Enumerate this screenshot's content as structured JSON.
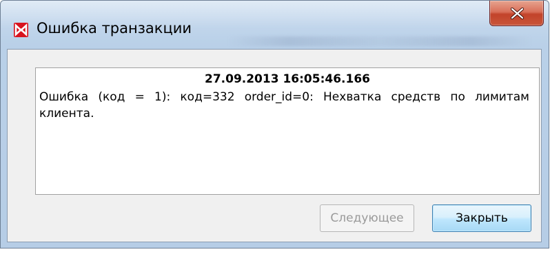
{
  "window": {
    "title": "Ошибка транзакции",
    "app_icon": "moex-logo-icon",
    "close_icon": "close-icon"
  },
  "message": {
    "timestamp": "27.09.2013 16:05:46.166",
    "text": "Ошибка (код = 1): код=332 order_id=0: Нехватка средств по лимитам клиента."
  },
  "buttons": {
    "next_label": "Следующее",
    "next_enabled": false,
    "close_label": "Закрыть"
  },
  "colors": {
    "icon_red": "#d8141f",
    "close_button_red": "#c9553a",
    "default_button_blue": "#3c7fb1"
  }
}
